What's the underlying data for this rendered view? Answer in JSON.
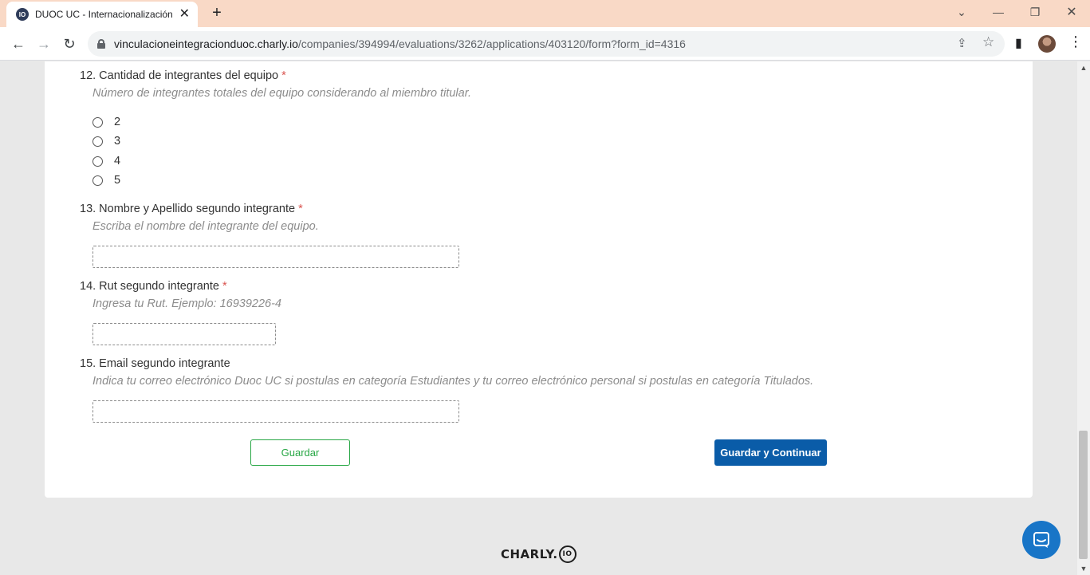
{
  "browser": {
    "tab_title": "DUOC UC - Internacionalización",
    "tab_favicon_text": "IO",
    "tab_close": "✕",
    "new_tab": "+",
    "url_host": "vinculacioneintegracionduoc.charly.io",
    "url_path": "/companies/394994/evaluations/3262/applications/403120/form?form_id=4316",
    "icons": {
      "back": "←",
      "forward": "→",
      "reload": "↻",
      "share": "⇪",
      "bookmark": "☆",
      "sidepanel": "▮",
      "menu": "⋮",
      "tab_search": "⌄",
      "minimize": "—",
      "restore": "❐",
      "close": "✕"
    }
  },
  "form": {
    "required_mark": "*",
    "q12": {
      "title": "12. Cantidad de integrantes del equipo",
      "required": true,
      "help": "Número de integrantes totales del equipo considerando al miembro titular.",
      "options": [
        "2",
        "3",
        "4",
        "5"
      ]
    },
    "q13": {
      "title": "13. Nombre y Apellido segundo integrante",
      "required": true,
      "help": "Escriba el nombre del integrante del equipo.",
      "value": ""
    },
    "q14": {
      "title": "14. Rut segundo integrante",
      "required": true,
      "help": "Ingresa tu Rut. Ejemplo: 16939226-4",
      "value": ""
    },
    "q15": {
      "title": "15. Email segundo integrante",
      "required": false,
      "help": "Indica tu correo electrónico Duoc UC si postulas en categoría Estudiantes y tu correo electrónico personal si postulas en categoría Titulados.",
      "value": ""
    },
    "buttons": {
      "save": "Guardar",
      "save_continue": "Guardar y Continuar"
    }
  },
  "footer": {
    "logo_text": "CHARLY.",
    "logo_badge": "IO"
  },
  "colors": {
    "tabstrip": "#f9d9c6",
    "primary_button": "#0a5ca8",
    "save_button": "#28a745",
    "required": "#d9534f",
    "chat": "#1875c7"
  }
}
